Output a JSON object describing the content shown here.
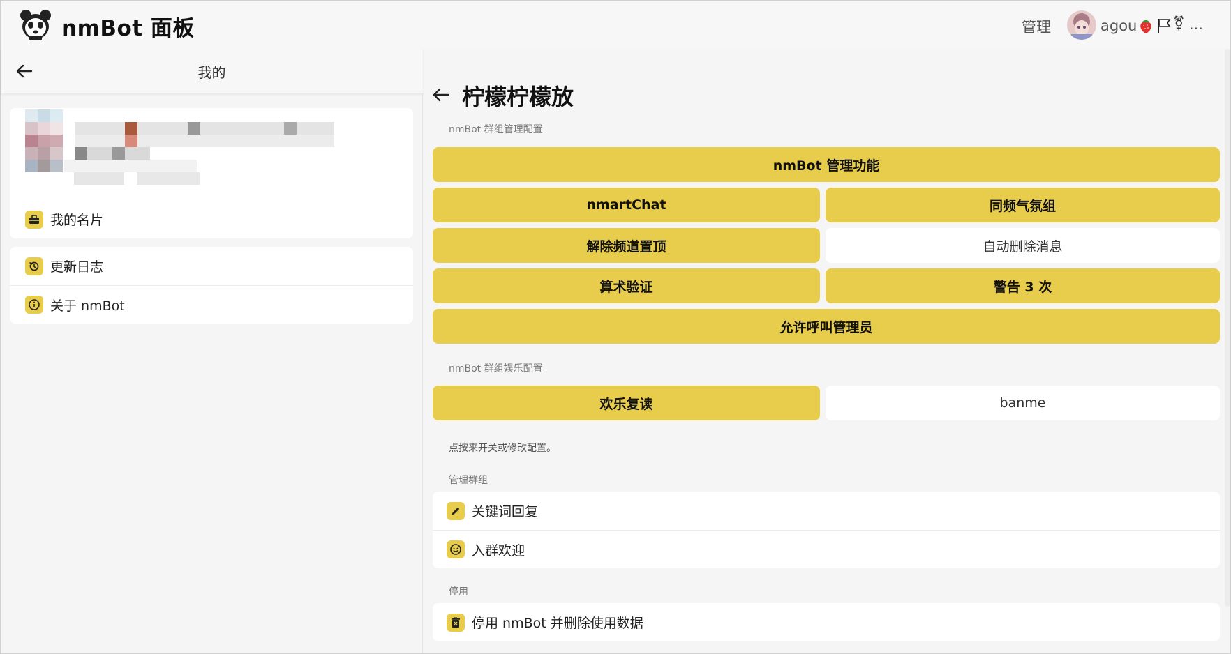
{
  "app": {
    "title": "nmBot 面板"
  },
  "header": {
    "admin_label": "管理",
    "username": "agou",
    "more_label": "…",
    "badges": [
      "strawberry-icon",
      "flag-icon",
      "gender-symbol-icon"
    ]
  },
  "left": {
    "title": "我的",
    "menu_group1": [
      {
        "label": "我的名片",
        "icon": "briefcase-icon"
      }
    ],
    "menu_group2": [
      {
        "label": "更新日志",
        "icon": "history-icon"
      },
      {
        "label": "关于 nmBot",
        "icon": "info-icon"
      }
    ]
  },
  "right": {
    "group_name": "柠檬柠檬放",
    "section_manage": "nmBot 群组管理配置",
    "manage_buttons": [
      {
        "label": "nmBot 管理功能",
        "enabled": true
      },
      {
        "label": "nmartChat",
        "enabled": true
      },
      {
        "label": "同频气氛组",
        "enabled": true
      },
      {
        "label": "解除频道置顶",
        "enabled": true
      },
      {
        "label": "自动删除消息",
        "enabled": false
      },
      {
        "label": "算术验证",
        "enabled": true
      },
      {
        "label": "警告 3 次",
        "enabled": true
      },
      {
        "label": "允许呼叫管理员",
        "enabled": true
      }
    ],
    "section_fun": "nmBot 群组娱乐配置",
    "fun_buttons": [
      {
        "label": "欢乐复读",
        "enabled": true
      },
      {
        "label": "banme",
        "enabled": false
      }
    ],
    "hint": "点按来开关或修改配置。",
    "section_group": "管理群组",
    "group_items": [
      {
        "label": "关键词回复",
        "icon": "pencil-icon"
      },
      {
        "label": "入群欢迎",
        "icon": "smile-icon"
      }
    ],
    "section_disable": "停用",
    "disable_items": [
      {
        "label": "停用 nmBot 并删除使用数据",
        "icon": "trash-icon"
      }
    ]
  },
  "colors": {
    "accent": "#e8cd4d",
    "background": "#f5f5f5",
    "card": "#ffffff"
  }
}
